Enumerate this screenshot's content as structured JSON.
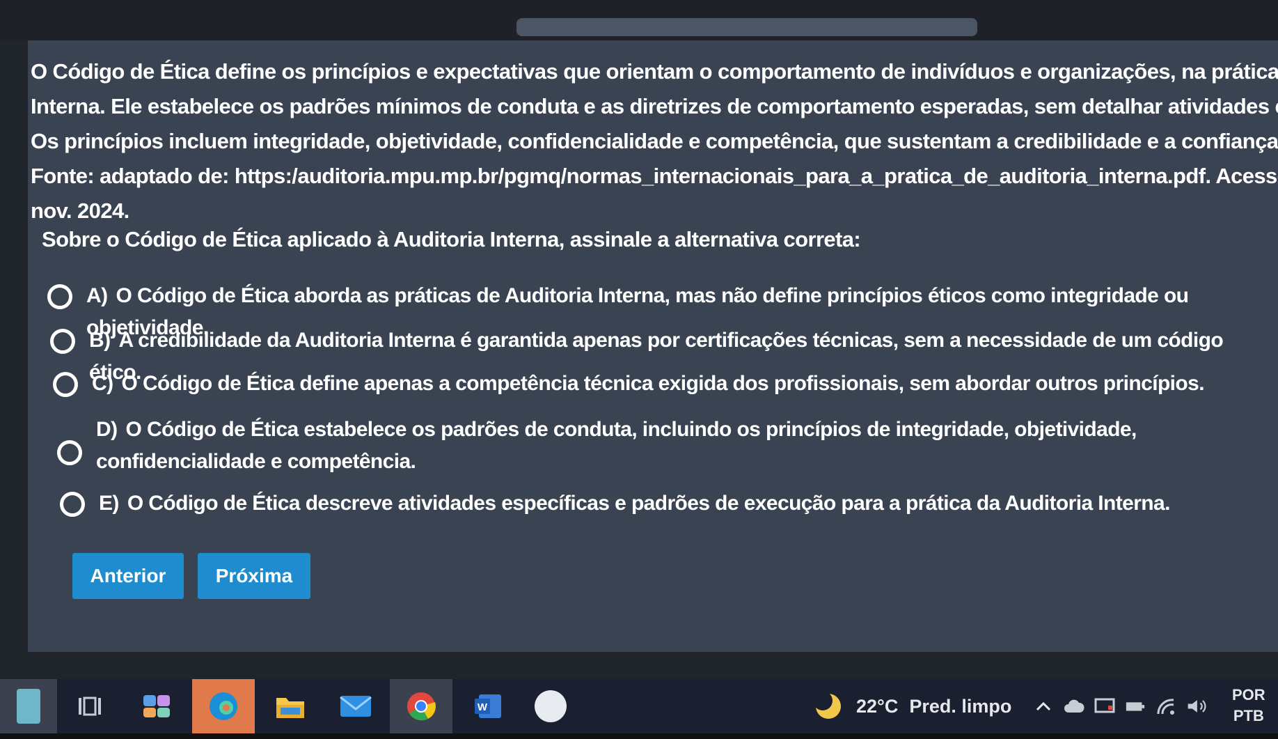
{
  "passage": {
    "lines": [
      "O Código de Ética define os princípios e expectativas que orientam o comportamento de indivíduos e organizações, na prática da Auc",
      "Interna. Ele estabelece os padrões mínimos de conduta e as diretrizes de comportamento esperadas, sem detalhar atividades espec",
      "Os princípios incluem integridade, objetividade, confidencialidade e competência, que sustentam a credibilidade e a confiança na prof",
      "Fonte: adaptado de: https:/auditoria.mpu.mp.br/pgmq/normas_internacionais_para_a_pratica_de_auditoria_interna.pdf. Acesso e",
      "nov. 2024."
    ]
  },
  "question": "Sobre o Código de Ética aplicado à Auditoria Interna, assinale a alternativa correta:",
  "options": [
    {
      "letter": "A)",
      "text": "O Código de Ética aborda as práticas de Auditoria Interna, mas não define princípios éticos como integridade ou objetividade."
    },
    {
      "letter": "B)",
      "text": "A credibilidade da Auditoria Interna é garantida apenas por certificações técnicas, sem a necessidade de um código ético."
    },
    {
      "letter": "C)",
      "text": "O Código de Ética define apenas a competência técnica exigida dos profissionais, sem abordar outros princípios."
    },
    {
      "letter": "D)",
      "text": "O Código de Ética estabelece os padrões de conduta, incluindo os princípios de integridade, objetividade, confidencialidade e competência."
    },
    {
      "letter": "E)",
      "text": "O Código de Ética descreve atividades específicas e padrões de execução para a prática da Auditoria Interna."
    }
  ],
  "buttons": {
    "prev": "Anterior",
    "next": "Próxima"
  },
  "taskbar": {
    "weather": "22°C",
    "weather_text": "Pred. limpo",
    "lang_top": "POR",
    "lang_bottom": "PTB",
    "icons": [
      "recycle-bin-icon",
      "task-view-icon",
      "widgets-icon",
      "edge-icon",
      "file-explorer-icon",
      "mail-icon",
      "chrome-icon",
      "word-icon",
      "app-icon"
    ]
  },
  "colors": {
    "content_bg": "#3a4352",
    "button_bg": "#1e8ccf",
    "taskbar_bg": "#1b2030"
  }
}
